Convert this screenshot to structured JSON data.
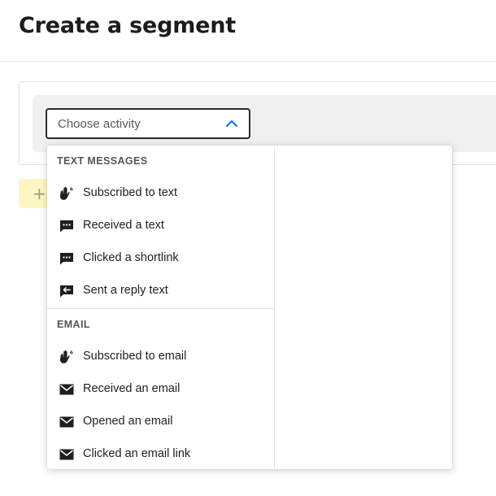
{
  "header": {
    "title": "Create a segment"
  },
  "segment_builder": {
    "activity_select": {
      "placeholder": "Choose activity",
      "state": "open"
    },
    "add_button": {
      "label": "+"
    }
  },
  "dropdown": {
    "groups": [
      {
        "heading": "TEXT MESSAGES",
        "options": [
          {
            "label": "Subscribed to text",
            "icon": "hand-wave-icon"
          },
          {
            "label": "Received a text",
            "icon": "message-icon"
          },
          {
            "label": "Clicked a shortlink",
            "icon": "message-icon"
          },
          {
            "label": "Sent a reply text",
            "icon": "reply-message-icon"
          }
        ]
      },
      {
        "heading": "EMAIL",
        "options": [
          {
            "label": "Subscribed to email",
            "icon": "hand-wave-icon"
          },
          {
            "label": "Received an email",
            "icon": "envelope-icon"
          },
          {
            "label": "Opened an email",
            "icon": "envelope-icon"
          },
          {
            "label": "Clicked an email link",
            "icon": "envelope-icon"
          }
        ]
      }
    ]
  },
  "colors": {
    "accent": "#1a73e8",
    "add_button_bg": "#fdf6c3",
    "condition_row_bg": "#eff0ef",
    "text": "#1f1f1f"
  }
}
